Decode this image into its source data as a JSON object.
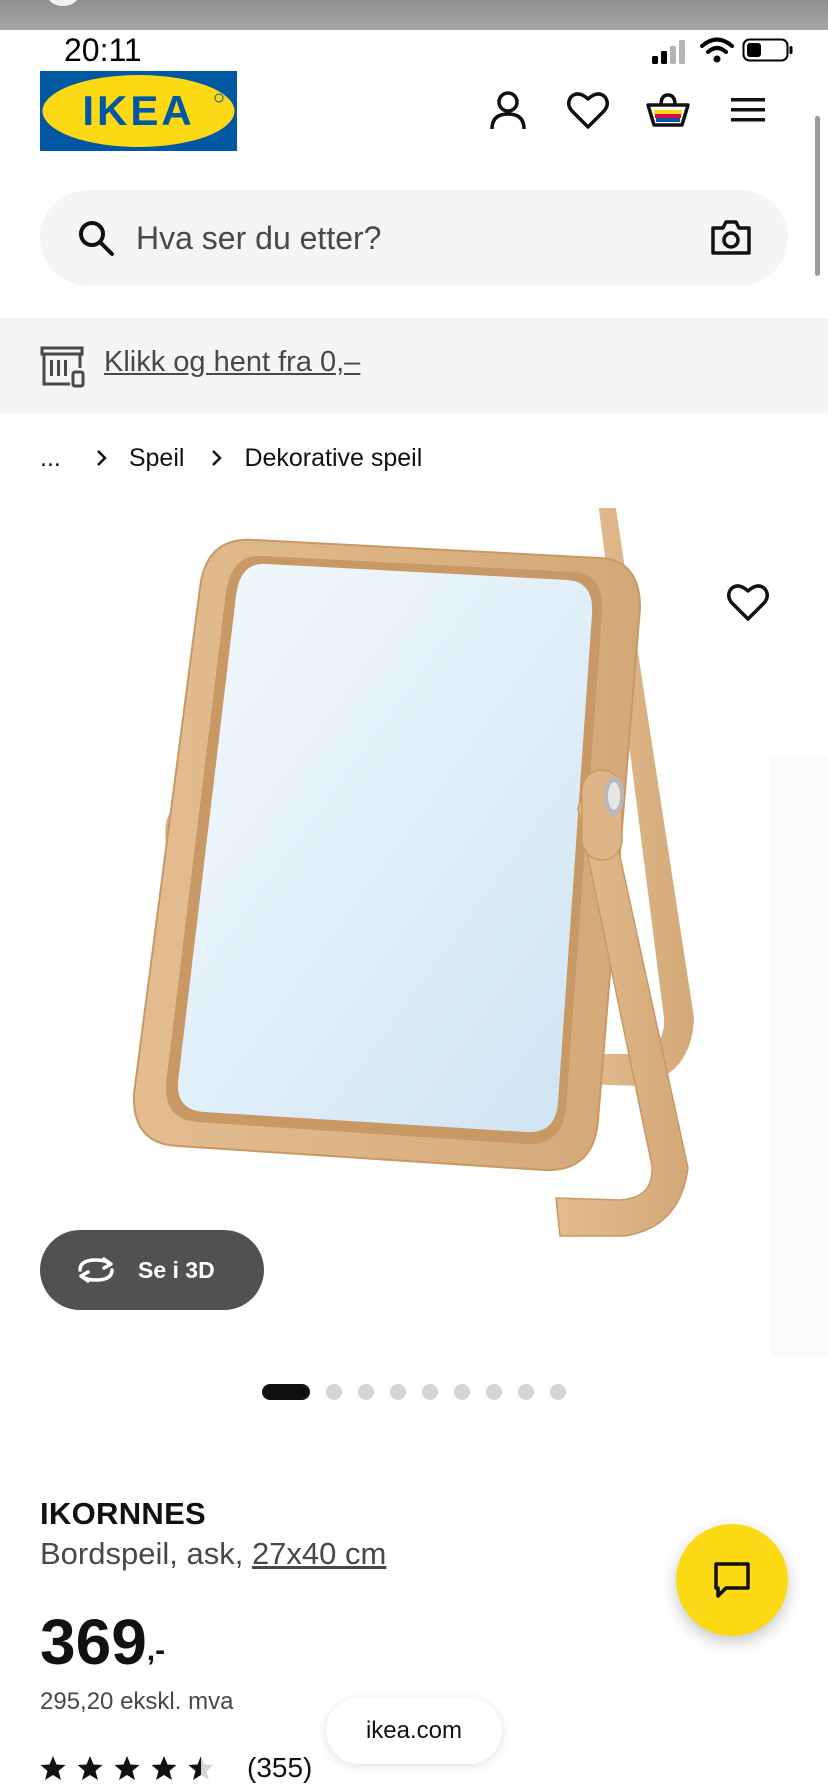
{
  "status_bar": {
    "time": "20:11"
  },
  "header": {
    "logo_text": "IKEA",
    "icons": [
      "user-icon",
      "heart-icon",
      "basket-icon",
      "menu-icon"
    ]
  },
  "search": {
    "placeholder": "Hva ser du etter?",
    "value": ""
  },
  "promo": {
    "link_text": "Klikk og hent fra 0,–"
  },
  "breadcrumb": {
    "items": [
      "...",
      "Speil",
      "Dekorative speil"
    ]
  },
  "gallery": {
    "button_3d_label": "Se i 3D",
    "slide_count": 9,
    "active_slide": 1
  },
  "product": {
    "name": "IKORNNES",
    "description": "Bordspeil, ask, ",
    "size": "27x40 cm",
    "price_integer": "369",
    "price_suffix": ",-",
    "price_excl_vat": "295,20 ekskl. mva",
    "rating": 4.5,
    "rating_count": "(355)"
  },
  "browser": {
    "domain": "ikea.com"
  },
  "colors": {
    "ikea_blue": "#0058a3",
    "ikea_yellow": "#fbd914",
    "text_primary": "#111111",
    "text_secondary": "#484848",
    "wood": "#dbb58a"
  }
}
